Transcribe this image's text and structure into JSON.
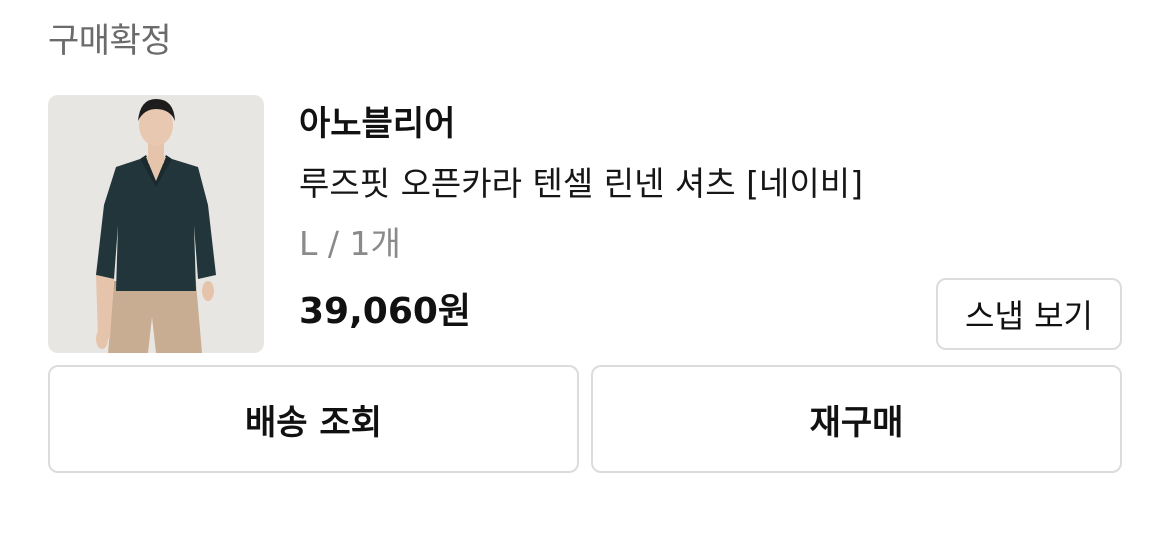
{
  "order": {
    "status": "구매확정"
  },
  "product": {
    "image_icon": "product-photo",
    "brand": "아노블리어",
    "name": "루즈핏 오픈카라 텐셀 린넨 셔츠 [네이비]",
    "option": "L / 1개",
    "price": "39,060원"
  },
  "actions": {
    "snap_label": "스냅 보기",
    "delivery_label": "배송 조회",
    "rebuy_label": "재구매"
  },
  "colors": {
    "border": "#dcdcdc",
    "muted_text": "#8a8a8a",
    "status_text": "#6b6b6b",
    "shirt": "#22353a",
    "pants": "#c9ad92"
  }
}
